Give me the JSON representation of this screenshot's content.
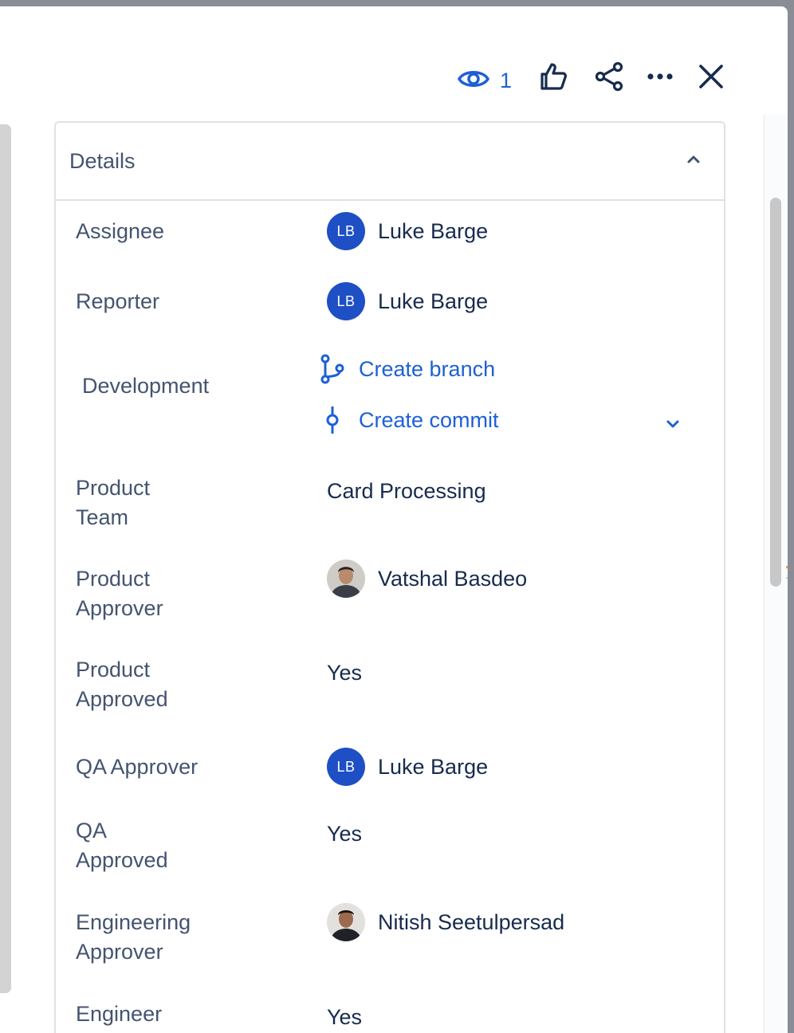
{
  "header": {
    "watch_count": "1",
    "icons": [
      "eye-icon",
      "thumbs-up-icon",
      "share-icon",
      "more-icon",
      "close-icon"
    ]
  },
  "details": {
    "title": "Details",
    "fields": {
      "assignee": {
        "label": "Assignee",
        "value": "Luke Barge",
        "initials": "LB"
      },
      "reporter": {
        "label": "Reporter",
        "value": "Luke Barge",
        "initials": "LB"
      },
      "development": {
        "label": "Development",
        "create_branch": "Create branch",
        "create_commit": "Create commit"
      },
      "product_team": {
        "label": "Product Team",
        "value": "Card Processing"
      },
      "product_approver": {
        "label": "Product Approver",
        "value": "Vatshal Basdeo"
      },
      "product_approved": {
        "label": "Product Approved",
        "value": "Yes"
      },
      "qa_approver": {
        "label": "QA Approver",
        "value": "Luke Barge",
        "initials": "LB"
      },
      "qa_approved": {
        "label": "QA Approved",
        "value": "Yes"
      },
      "engineering_approver": {
        "label": "Engineering Approver",
        "value": "Nitish Seetulpersad"
      },
      "engineer_approved": {
        "label": "Engineer Approved",
        "value": "Yes"
      }
    }
  },
  "colors": {
    "link": "#1d60d6",
    "avatar": "#1e4fc4",
    "label": "#44546f",
    "text": "#172b4d"
  }
}
